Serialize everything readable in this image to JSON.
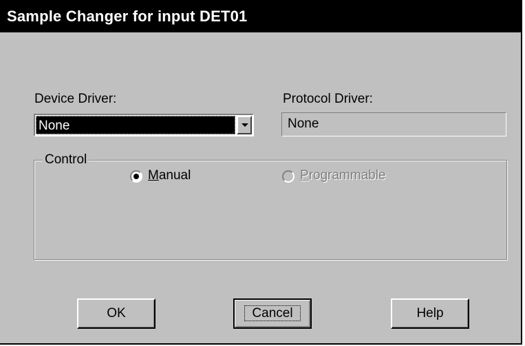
{
  "window": {
    "title": "Sample Changer for input DET01"
  },
  "device_driver": {
    "label": "Device Driver:",
    "selected_value": "None"
  },
  "protocol_driver": {
    "label": "Protocol Driver:",
    "value": "None"
  },
  "control": {
    "legend": "Control",
    "options": [
      {
        "access_key": "M",
        "rest": "anual",
        "selected": true,
        "enabled": true
      },
      {
        "access_key": "P",
        "rest": "rogrammable",
        "selected": false,
        "enabled": false
      }
    ]
  },
  "buttons": {
    "ok_label": "OK",
    "cancel_label": "Cancel",
    "help_label": "Help"
  },
  "colors": {
    "face": "#c0c0c0",
    "titlebar": "#000000",
    "title_text": "#ffffff",
    "selection": "#000000",
    "disabled_text": "#808080"
  },
  "icons": {
    "dropdown": "chevron-down-icon",
    "radio_on": "radio-selected-icon",
    "radio_off": "radio-unselected-icon"
  }
}
